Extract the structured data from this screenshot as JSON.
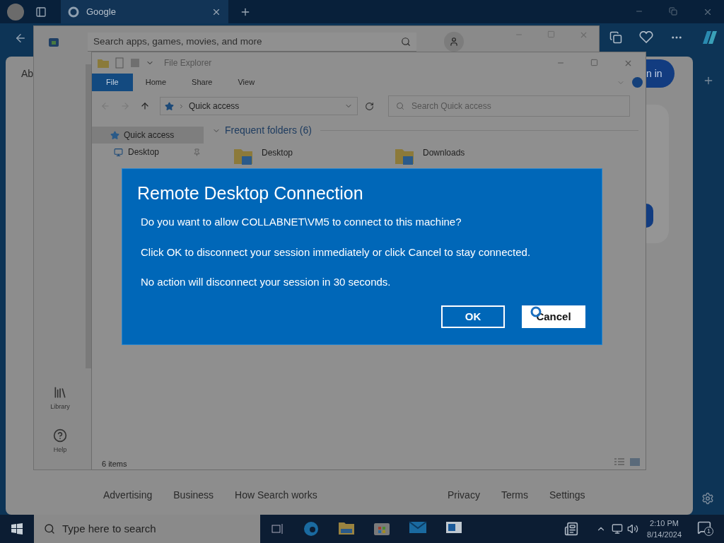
{
  "browser": {
    "tab_title": "Google",
    "page_fragment": "Ab",
    "sign_in_fragment": "n in",
    "footer_links": [
      "Advertising",
      "Business",
      "How Search works",
      "Privacy",
      "Terms",
      "Settings"
    ]
  },
  "store": {
    "search_placeholder": "Search apps, games, movies, and more",
    "nav": [
      {
        "label": "Library"
      },
      {
        "label": "Help"
      }
    ]
  },
  "explorer": {
    "title": "File Explorer",
    "ribbon_tabs": [
      {
        "label": "File",
        "selected": true
      },
      {
        "label": "Home",
        "selected": false
      },
      {
        "label": "Share",
        "selected": false
      },
      {
        "label": "View",
        "selected": false
      }
    ],
    "address": "Quick access",
    "search_placeholder": "Search Quick access",
    "nav": [
      {
        "label": "Quick access",
        "selected": true,
        "pinned": false
      },
      {
        "label": "Desktop",
        "selected": false,
        "pinned": true
      }
    ],
    "group_title": "Frequent folders (6)",
    "folders": [
      {
        "name": "Desktop"
      },
      {
        "name": "Downloads"
      }
    ],
    "status": "6 items"
  },
  "dialog": {
    "title": "Remote Desktop Connection",
    "messages": [
      "Do you want to allow COLLABNET\\VM5 to connect to this machine?",
      "Click OK to disconnect your session immediately or click Cancel to stay connected.",
      "No action will disconnect your session in 30 seconds."
    ],
    "buttons": [
      {
        "label": "OK",
        "selected": false
      },
      {
        "label": "Cancel",
        "selected": true
      }
    ]
  },
  "taskbar": {
    "search_placeholder": "Type here to search",
    "time": "2:10 PM",
    "date": "8/14/2024",
    "notification_count": "1"
  }
}
